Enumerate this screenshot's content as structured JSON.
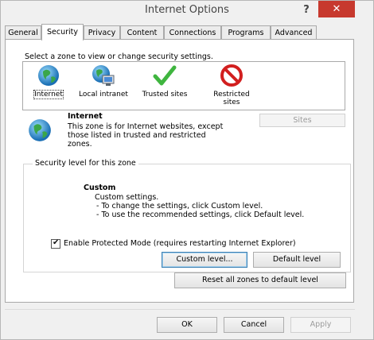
{
  "window": {
    "title": "Internet Options",
    "help_label": "?",
    "close_label": "✕"
  },
  "tabs": [
    {
      "label": "General",
      "active": false
    },
    {
      "label": "Security",
      "active": true
    },
    {
      "label": "Privacy",
      "active": false
    },
    {
      "label": "Content",
      "active": false
    },
    {
      "label": "Connections",
      "active": false
    },
    {
      "label": "Programs",
      "active": false
    },
    {
      "label": "Advanced",
      "active": false
    }
  ],
  "security": {
    "zone_prompt": "Select a zone to view or change security settings.",
    "zones": [
      {
        "label": "Internet",
        "icon": "globe-icon",
        "selected": true
      },
      {
        "label": "Local intranet",
        "icon": "intranet-icon",
        "selected": false
      },
      {
        "label": "Trusted sites",
        "icon": "checkmark-icon",
        "selected": false
      },
      {
        "label": "Restricted sites",
        "icon": "prohibited-icon",
        "selected": false
      }
    ],
    "selected_zone": {
      "name": "Internet",
      "description": "This zone is for Internet websites, except those listed in trusted and restricted zones."
    },
    "sites_label": "Sites",
    "level_group_title": "Security level for this zone",
    "level_name": "Custom",
    "level_desc": "Custom settings.",
    "level_hint_1": "- To change the settings, click Custom level.",
    "level_hint_2": "- To use the recommended settings, click Default level.",
    "protected_mode_label": "Enable Protected Mode (requires restarting Internet Explorer)",
    "protected_mode_checked": true,
    "custom_level_label": "Custom level...",
    "default_level_label": "Default level",
    "reset_all_label": "Reset all zones to default level"
  },
  "footer": {
    "ok_label": "OK",
    "cancel_label": "Cancel",
    "apply_label": "Apply"
  },
  "colors": {
    "close_button": "#c7392e",
    "accent_focus": "#3c7fb1"
  }
}
